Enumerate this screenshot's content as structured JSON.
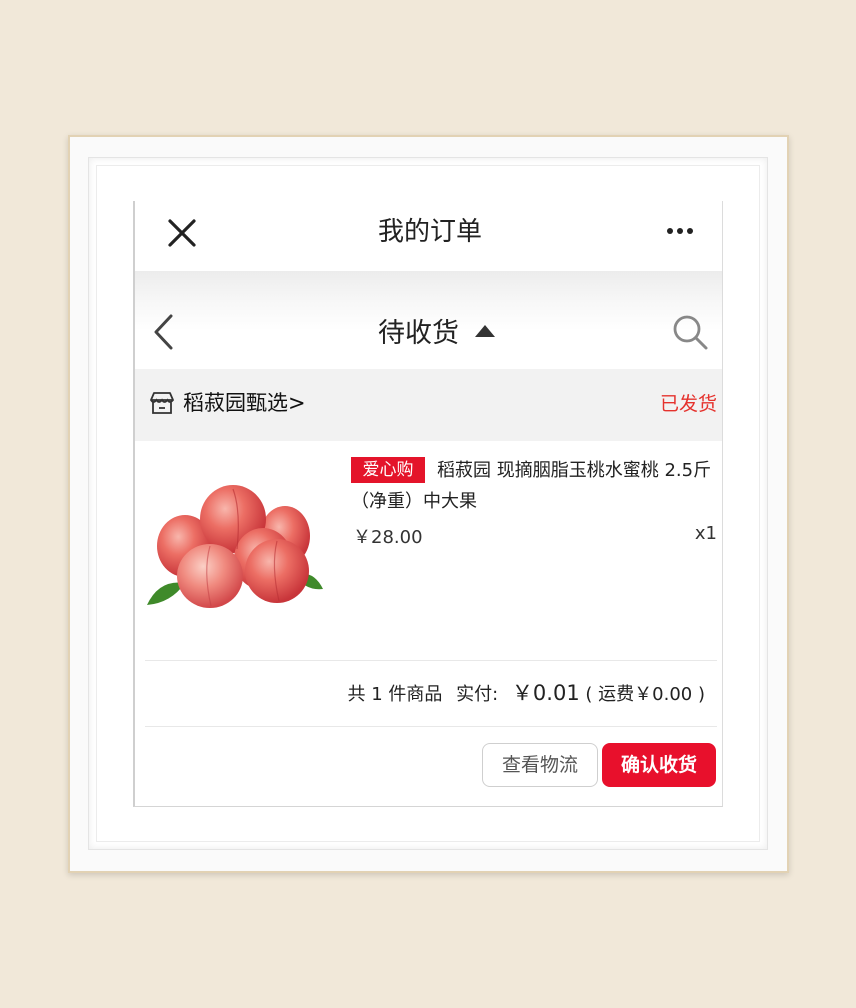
{
  "topbar": {
    "title": "我的订单",
    "close_icon": "close-icon",
    "more_icon": "more-icon"
  },
  "subbar": {
    "title": "待收货",
    "back_icon": "chevron-left-icon",
    "caret_icon": "caret-up-icon",
    "search_icon": "search-icon"
  },
  "order": {
    "store_name": "稻菽园甄选>",
    "store_icon": "store-icon",
    "status": "已发货",
    "product": {
      "tag": "爱心购",
      "title": "稻菽园 现摘胭脂玉桃水蜜桃 2.5斤（净重）中大果",
      "price": "￥28.00",
      "quantity": "x1",
      "image": "peach-image"
    },
    "summary": {
      "count_text": "共 1 件商品",
      "paid_label": "实付:",
      "paid_amount": "￥0.01",
      "shipping_text": "( 运费￥0.00 )"
    },
    "actions": {
      "logistics_label": "查看物流",
      "confirm_label": "确认收货"
    }
  },
  "colors": {
    "accent": "#e8102c",
    "status": "#e5322d",
    "page_background": "#f1e8d9"
  }
}
